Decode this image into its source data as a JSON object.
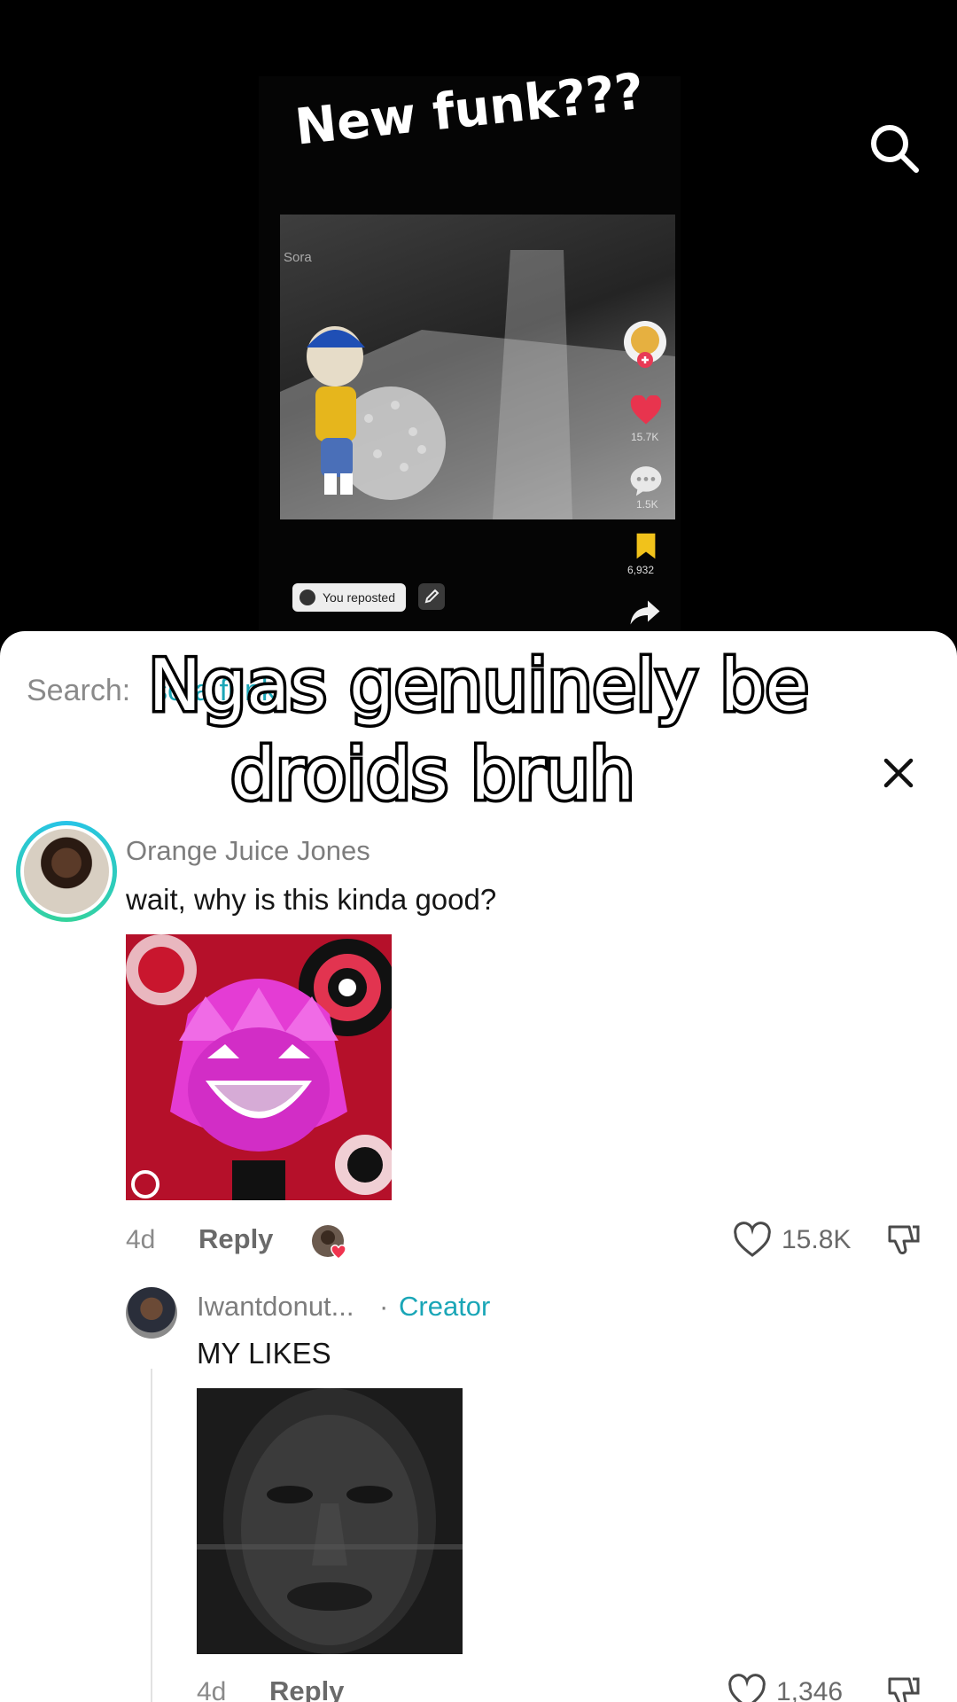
{
  "video": {
    "inner_title": "New funk???",
    "inner_source_label": "Sora",
    "inner_sidebar_count_1": "15.7K",
    "inner_sidebar_count_2": "1.5K",
    "inner_bookmark_count": "6,932",
    "inner_repost_label": "You reposted"
  },
  "caption": {
    "line1": "Ngas genuinely be",
    "line2": "droids bruh",
    "emoji": "😭"
  },
  "search": {
    "label": "Search:",
    "term": "sora funk"
  },
  "comments": [
    {
      "username": "Orange Juice Jones",
      "text": "wait, why is this kinda good?",
      "time": "4d",
      "reply_label": "Reply",
      "like_count": "15.8K"
    },
    {
      "username": "Iwantdonut...",
      "separator": "·",
      "badge": "Creator",
      "text": "MY LIKES",
      "time": "4d",
      "reply_label": "Reply",
      "like_count": "1,346"
    }
  ],
  "icons": {
    "search": "search-icon",
    "close": "close-icon",
    "like": "heart-outline-icon",
    "dislike": "thumbs-down-icon"
  },
  "colors": {
    "accent": "#1aa6b7",
    "sheet_bg": "#ffffff",
    "video_bg": "#000000"
  }
}
